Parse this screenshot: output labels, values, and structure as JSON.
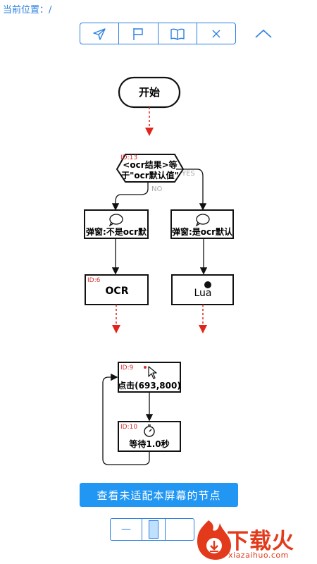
{
  "location": {
    "label": "当前位置：/"
  },
  "toolbar": {
    "items": [
      {
        "icon": "send-icon"
      },
      {
        "icon": "flag-icon"
      },
      {
        "icon": "book-icon"
      },
      {
        "icon": "close-icon"
      }
    ],
    "collapse_icon": "chevron-up-icon"
  },
  "flow": {
    "start_label": "开始",
    "decision": {
      "id": "ID:13",
      "line1": "<ocr结果>等",
      "line2": "于\"ocr默认值\"",
      "yes": "YES",
      "no": "NO"
    },
    "popup_left": {
      "label": "弹窗:不是ocr默"
    },
    "popup_right": {
      "label": "弹窗:是ocr默认"
    },
    "ocr_node": {
      "id": "ID:6",
      "label": "OCR"
    },
    "lua_node": {
      "label": "Lua"
    },
    "click_node": {
      "id": "ID:9",
      "label": "点击(693,800)"
    },
    "wait_node": {
      "id": "ID:10",
      "label": "等待1.0秒"
    }
  },
  "colors": {
    "accent": "#2a7fe0",
    "button": "#2196f3",
    "id_red": "#d32f2f",
    "watermark": "#e23a1b"
  },
  "match_button": {
    "label": "查看未适配本屏幕的节点"
  },
  "zoom": {
    "minus": "—"
  },
  "watermark": {
    "brand": "下载火",
    "url": "xiazaihuo.com"
  }
}
